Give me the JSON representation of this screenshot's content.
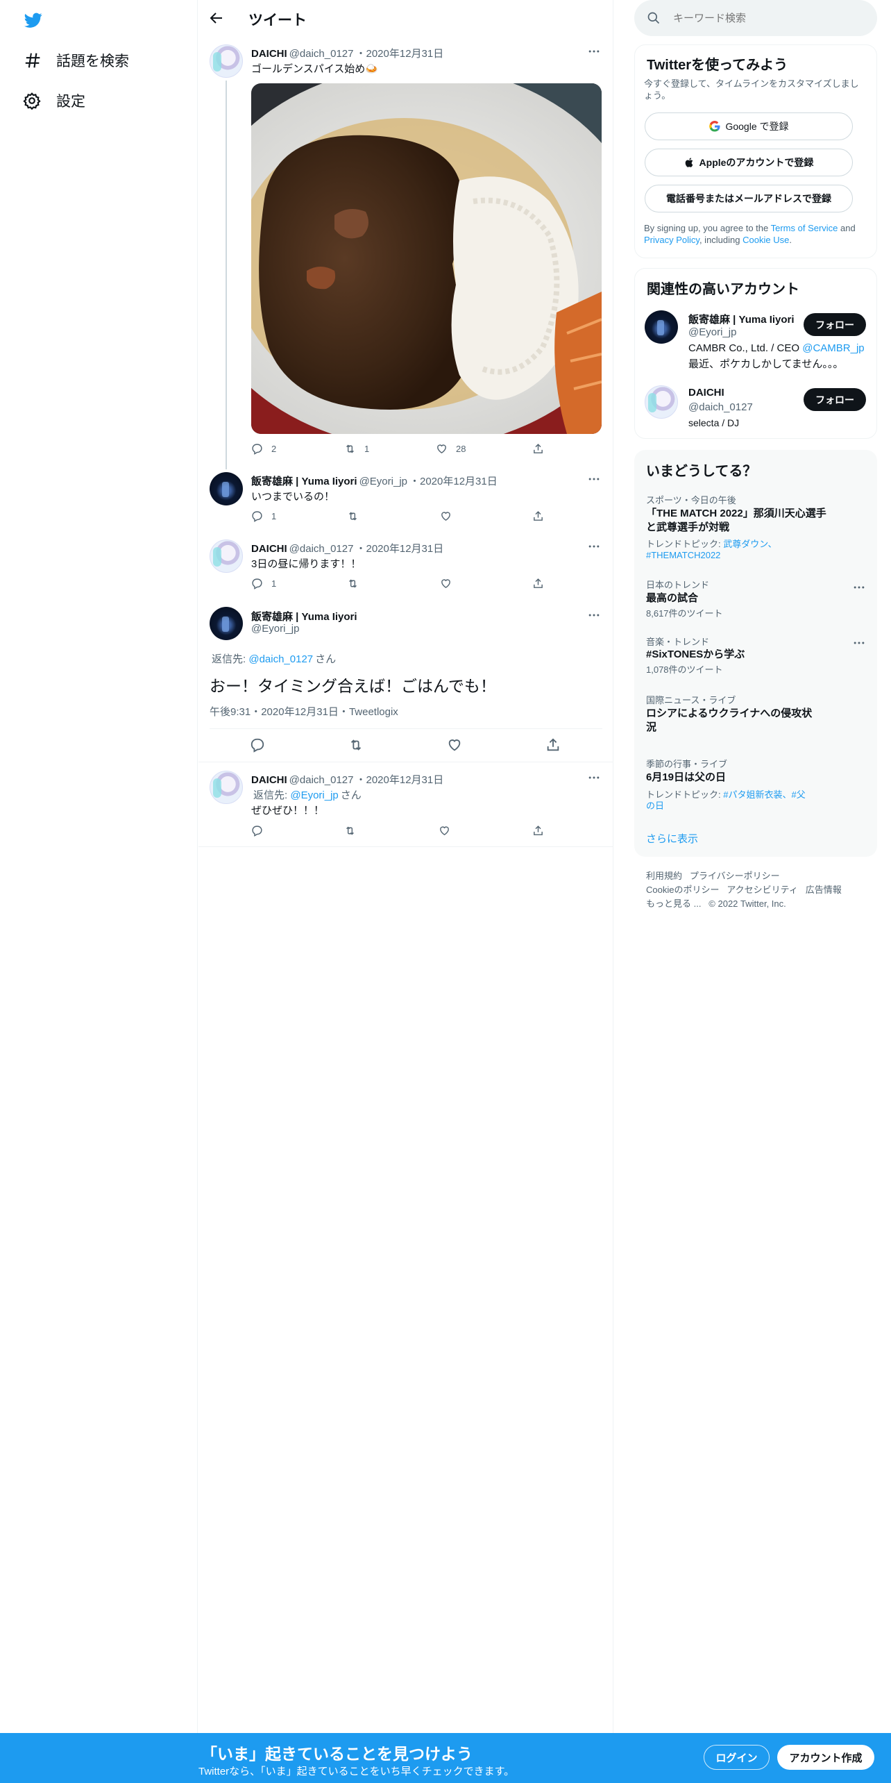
{
  "nav": {
    "explore_label": "話題を検索",
    "settings_label": "設定"
  },
  "header": {
    "title": "ツイート"
  },
  "tweets": [
    {
      "name": "DAICHI",
      "handle": "@daich_0127",
      "date": "・2020年12月31日",
      "text": "ゴールデンスパイス始め🍛",
      "replies": "2",
      "retweets": "1",
      "likes": "28"
    },
    {
      "name": "飯寄雄麻 | Yuma Iiyori",
      "handle": "@Eyori_jp",
      "date": "・2020年12月31日",
      "text": "いつまでいるの！",
      "replies": "1"
    },
    {
      "name": "DAICHI",
      "handle": "@daich_0127",
      "date": "・2020年12月31日",
      "text": "3日の昼に帰ります！！",
      "replies": "1"
    }
  ],
  "focused": {
    "name": "飯寄雄麻 | Yuma Iiyori",
    "handle": "@Eyori_jp",
    "reply_prefix": "返信先: ",
    "reply_to": "@daich_0127",
    "reply_suffix": "さん",
    "text": "おー！タイミング合えば！ごはんでも！",
    "time": "午後9:31・2020年12月31日・",
    "client": "Tweetlogix"
  },
  "reply": {
    "name": "DAICHI",
    "handle": "@daich_0127",
    "date": "・2020年12月31日",
    "reply_prefix": "返信先: ",
    "reply_to": "@Eyori_jp",
    "reply_suffix": "さん",
    "text": "ぜひぜひ！！！"
  },
  "search": {
    "placeholder": "キーワード検索"
  },
  "signup": {
    "title": "Twitterを使ってみよう",
    "subtitle": "今すぐ登録して、タイムラインをカスタマイズしましょう。",
    "google": "Google で登録",
    "apple": "Appleのアカウントで登録",
    "phone": "電話番号またはメールアドレスで登録",
    "terms_1": "By signing up, you agree to the ",
    "terms_link": "Terms of Service",
    "terms_2": " and ",
    "privacy_link": "Privacy Policy",
    "terms_3": ", including ",
    "cookie_link": "Cookie Use",
    "terms_4": "."
  },
  "related": {
    "title": "関連性の高いアカウント",
    "accounts": [
      {
        "name": "飯寄雄麻 | Yuma Iiyori",
        "handle": "@Eyori_jp",
        "bio_1": "CAMBR Co., Ltd. / CEO ",
        "bio_link": "@CAMBR_jp",
        "bio_2": "最近、ポケカしかしてません。。。",
        "follow": "フォロー"
      },
      {
        "name": "DAICHI",
        "handle": "@daich_0127",
        "bio_1": "selecta / DJ",
        "follow": "フォロー"
      }
    ]
  },
  "trends": {
    "title": "いまどうしてる？",
    "items": [
      {
        "category": "スポーツ・今日の午後",
        "name": "「THE MATCH 2022」那須川天心選手と武尊選手が対戦",
        "sub_prefix": "トレンドトピック: ",
        "sub_links": "武尊ダウン、#THEMATCH2022"
      },
      {
        "category": "日本のトレンド",
        "name": "最高の試合",
        "count": "8,617件のツイート"
      },
      {
        "category": "音楽・トレンド",
        "name": "#SixTONESから学ぶ",
        "count": "1,078件のツイート"
      },
      {
        "category": "国際ニュース・ライブ",
        "name": "ロシアによるウクライナへの侵攻状況"
      },
      {
        "category": "季節の行事・ライブ",
        "name": "6月19日は父の日",
        "sub_prefix": "トレンドトピック: ",
        "sub_links": "#パタ姐新衣装、#父の日"
      }
    ],
    "show_more": "さらに表示"
  },
  "footer": {
    "line1": [
      "利用規約",
      "プライバシーポリシー"
    ],
    "line2": [
      "Cookieのポリシー",
      "アクセシビリティ",
      "広告情報"
    ],
    "more": "もっと見る ...",
    "copyright": "© 2022 Twitter, Inc."
  },
  "banner": {
    "title": "「いま」起きていることを見つけよう",
    "subtitle": "Twitterなら、「いま」起きていることをいち早くチェックできます。",
    "login": "ログイン",
    "signup": "アカウント作成"
  },
  "colors": {
    "brand": "#1d9bf0",
    "text": "#0f1419",
    "muted": "#536471"
  }
}
